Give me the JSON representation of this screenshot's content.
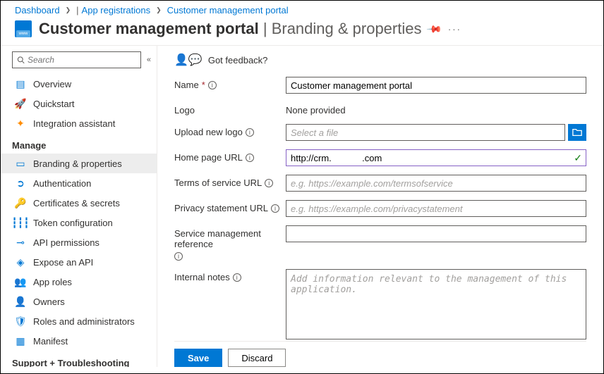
{
  "breadcrumb": {
    "items": [
      "Dashboard",
      "App registrations",
      "Customer management portal"
    ]
  },
  "header": {
    "title": "Customer management portal",
    "subtitle": "Branding & properties"
  },
  "sidebar": {
    "search_placeholder": "Search",
    "items": [
      {
        "icon": "overview",
        "label": "Overview"
      },
      {
        "icon": "quickstart",
        "label": "Quickstart"
      },
      {
        "icon": "assistant",
        "label": "Integration assistant"
      }
    ],
    "section_manage": "Manage",
    "manage_items": [
      {
        "icon": "branding",
        "label": "Branding & properties",
        "selected": true
      },
      {
        "icon": "auth",
        "label": "Authentication"
      },
      {
        "icon": "cert",
        "label": "Certificates & secrets"
      },
      {
        "icon": "token",
        "label": "Token configuration"
      },
      {
        "icon": "api-perm",
        "label": "API permissions"
      },
      {
        "icon": "expose",
        "label": "Expose an API"
      },
      {
        "icon": "roles",
        "label": "App roles"
      },
      {
        "icon": "owners",
        "label": "Owners"
      },
      {
        "icon": "roles-admin",
        "label": "Roles and administrators"
      },
      {
        "icon": "manifest",
        "label": "Manifest"
      }
    ],
    "section_support": "Support + Troubleshooting"
  },
  "feedback": {
    "label": "Got feedback?"
  },
  "form": {
    "name": {
      "label": "Name",
      "value": "Customer management portal"
    },
    "logo": {
      "label": "Logo",
      "value": "None provided"
    },
    "upload": {
      "label": "Upload new logo",
      "placeholder": "Select a file"
    },
    "homepage": {
      "label": "Home page URL",
      "value": "http://crm.            .com"
    },
    "tos": {
      "label": "Terms of service URL",
      "placeholder": "e.g. https://example.com/termsofservice"
    },
    "privacy": {
      "label": "Privacy statement URL",
      "placeholder": "e.g. https://example.com/privacystatement"
    },
    "service_ref": {
      "label": "Service management reference"
    },
    "notes": {
      "label": "Internal notes",
      "placeholder": "Add information relevant to the management of this application."
    }
  },
  "footer": {
    "save": "Save",
    "discard": "Discard"
  }
}
